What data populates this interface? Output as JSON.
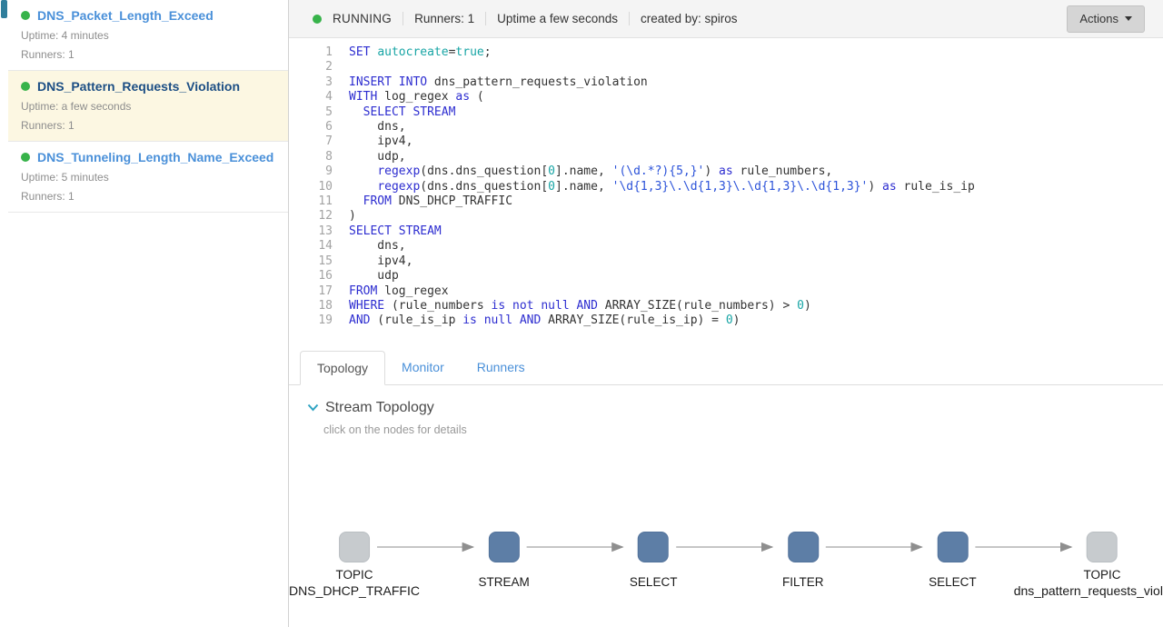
{
  "colors": {
    "accent_blue": "#4a90d9",
    "selected_navy": "#1c4e84",
    "status_green": "#37b34a",
    "selected_bg": "#fcf7e2",
    "node_topic": "#c7cbce",
    "node_op": "#5d7ea6",
    "kw": "#2d2dd0",
    "str": "#2b52d9",
    "teal": "#18a5a5",
    "chevron_teal": "#2fa3c2"
  },
  "sidebar": {
    "jobs": [
      {
        "name": "DNS_Packet_Length_Exceed",
        "uptime": "Uptime: 4 minutes",
        "runners": "Runners: 1",
        "selected": false
      },
      {
        "name": "DNS_Pattern_Requests_Violation",
        "uptime": "Uptime: a few seconds",
        "runners": "Runners: 1",
        "selected": true
      },
      {
        "name": "DNS_Tunneling_Length_Name_Exceed",
        "uptime": "Uptime: 5 minutes",
        "runners": "Runners: 1",
        "selected": false
      }
    ]
  },
  "header": {
    "status": "RUNNING",
    "runners": "Runners: 1",
    "uptime": "Uptime a few seconds",
    "created_by": "created by: spiros",
    "actions_label": "Actions"
  },
  "editor": {
    "lines": [
      [
        [
          "kw",
          "SET"
        ],
        [
          "pl",
          " "
        ],
        [
          "prop",
          "autocreate"
        ],
        [
          "pl",
          "="
        ],
        [
          "const",
          "true"
        ],
        [
          "pl",
          ";"
        ]
      ],
      [],
      [
        [
          "kw",
          "INSERT INTO"
        ],
        [
          "pl",
          " dns_pattern_requests_violation"
        ]
      ],
      [
        [
          "kw",
          "WITH"
        ],
        [
          "pl",
          " log_regex "
        ],
        [
          "kw",
          "as"
        ],
        [
          "pl",
          " ("
        ]
      ],
      [
        [
          "pl",
          "  "
        ],
        [
          "kw",
          "SELECT STREAM"
        ]
      ],
      [
        [
          "pl",
          "    dns,"
        ]
      ],
      [
        [
          "pl",
          "    ipv4,"
        ]
      ],
      [
        [
          "pl",
          "    udp,"
        ]
      ],
      [
        [
          "pl",
          "    "
        ],
        [
          "fn",
          "regexp"
        ],
        [
          "pl",
          "(dns.dns_question["
        ],
        [
          "num",
          "0"
        ],
        [
          "pl",
          "].name, "
        ],
        [
          "str",
          "'(\\d.*?){5,}'"
        ],
        [
          "pl",
          ") "
        ],
        [
          "kw",
          "as"
        ],
        [
          "pl",
          " rule_numbers,"
        ]
      ],
      [
        [
          "pl",
          "    "
        ],
        [
          "fn",
          "regexp"
        ],
        [
          "pl",
          "(dns.dns_question["
        ],
        [
          "num",
          "0"
        ],
        [
          "pl",
          "].name, "
        ],
        [
          "str",
          "'\\d{1,3}\\.\\d{1,3}\\.\\d{1,3}\\.\\d{1,3}'"
        ],
        [
          "pl",
          ") "
        ],
        [
          "kw",
          "as"
        ],
        [
          "pl",
          " rule_is_ip"
        ]
      ],
      [
        [
          "pl",
          "  "
        ],
        [
          "kw",
          "FROM"
        ],
        [
          "pl",
          " DNS_DHCP_TRAFFIC"
        ]
      ],
      [
        [
          "pl",
          ")"
        ]
      ],
      [
        [
          "kw",
          "SELECT STREAM"
        ]
      ],
      [
        [
          "pl",
          "    dns,"
        ]
      ],
      [
        [
          "pl",
          "    ipv4,"
        ]
      ],
      [
        [
          "pl",
          "    udp"
        ]
      ],
      [
        [
          "kw",
          "FROM"
        ],
        [
          "pl",
          " log_regex"
        ]
      ],
      [
        [
          "kw",
          "WHERE"
        ],
        [
          "pl",
          " (rule_numbers "
        ],
        [
          "kw",
          "is not null"
        ],
        [
          "pl",
          " "
        ],
        [
          "kw",
          "AND"
        ],
        [
          "pl",
          " ARRAY_SIZE(rule_numbers) > "
        ],
        [
          "num",
          "0"
        ],
        [
          "pl",
          ")"
        ]
      ],
      [
        [
          "kw",
          "AND"
        ],
        [
          "pl",
          " (rule_is_ip "
        ],
        [
          "kw",
          "is null"
        ],
        [
          "pl",
          " "
        ],
        [
          "kw",
          "AND"
        ],
        [
          "pl",
          " ARRAY_SIZE(rule_is_ip) = "
        ],
        [
          "num",
          "0"
        ],
        [
          "pl",
          ")"
        ]
      ]
    ]
  },
  "tabs": [
    {
      "label": "Topology",
      "active": true
    },
    {
      "label": "Monitor",
      "active": false
    },
    {
      "label": "Runners",
      "active": false
    }
  ],
  "topology": {
    "title": "Stream Topology",
    "hint": "click on the nodes for details",
    "nodes": [
      {
        "kind": "topic",
        "type_label": "TOPIC",
        "name": "DNS_DHCP_TRAFFIC"
      },
      {
        "kind": "op",
        "type_label": "STREAM"
      },
      {
        "kind": "op",
        "type_label": "SELECT"
      },
      {
        "kind": "op",
        "type_label": "FILTER"
      },
      {
        "kind": "op",
        "type_label": "SELECT"
      },
      {
        "kind": "topic",
        "type_label": "TOPIC",
        "name": "dns_pattern_requests_violation"
      }
    ]
  }
}
